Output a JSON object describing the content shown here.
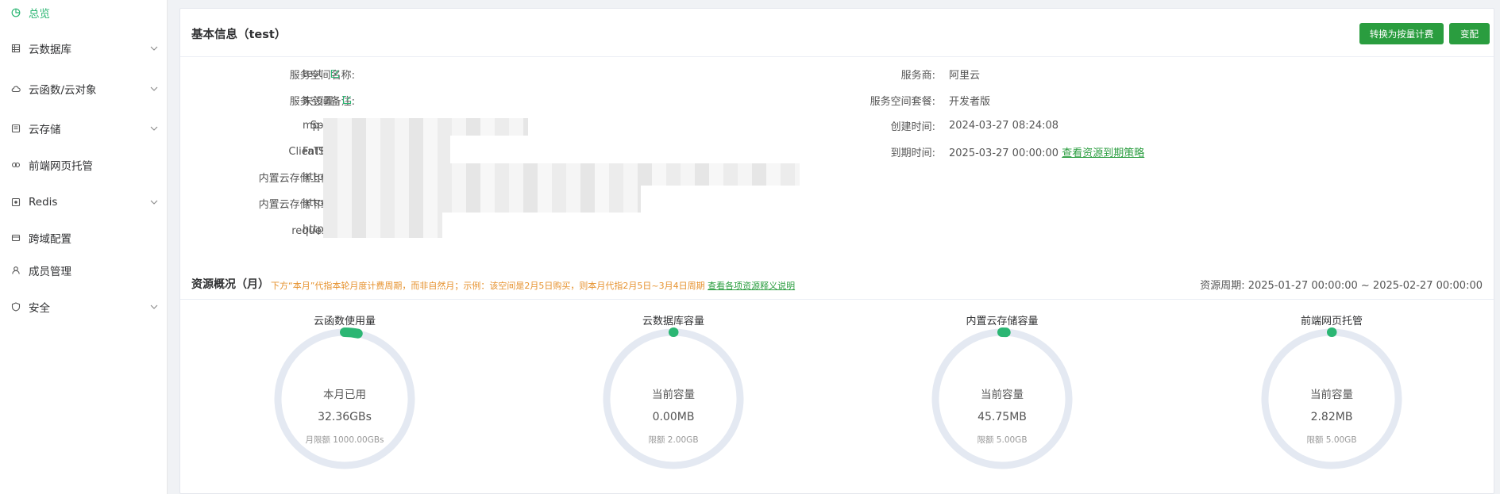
{
  "sidebar": {
    "items": [
      {
        "label": "总览",
        "icon": "overview-icon",
        "active": true
      },
      {
        "label": "云数据库",
        "icon": "database-icon",
        "expandable": true
      },
      {
        "label": "云函数/云对象",
        "icon": "cloud-icon",
        "expandable": true
      },
      {
        "label": "云存储",
        "icon": "storage-icon",
        "expandable": true
      },
      {
        "label": "前端网页托管",
        "icon": "hosting-icon"
      },
      {
        "label": "Redis",
        "icon": "redis-icon",
        "expandable": true
      },
      {
        "label": "跨域配置",
        "icon": "cors-icon"
      },
      {
        "label": "成员管理",
        "icon": "member-icon"
      },
      {
        "label": "安全",
        "icon": "shield-icon",
        "expandable": true
      }
    ]
  },
  "basic": {
    "title": "基本信息（test）",
    "btn_convert": "转换为按量计费",
    "btn_change": "变配",
    "left": [
      {
        "key": "服务空间名称:",
        "value": "test"
      },
      {
        "key": "服务空间备注:",
        "value": "未设置"
      },
      {
        "key": "SpaceId:",
        "value": "mp-"
      },
      {
        "key": "ClientSecret:",
        "value": "FaTF"
      },
      {
        "key": "内置云存储上传域名:",
        "value": "https:"
      },
      {
        "key": "内置云存储下载域名:",
        "value": "https:"
      },
      {
        "key": "request域名:",
        "value": "https:"
      }
    ],
    "right": [
      {
        "key": "服务商:",
        "value": "阿里云"
      },
      {
        "key": "服务空间套餐:",
        "value": "开发者版"
      },
      {
        "key": "创建时间:",
        "value": "2024-03-27 08:24:08"
      },
      {
        "key": "到期时间:",
        "value": "2025-03-27 00:00:00"
      }
    ],
    "expire_link": "查看资源到期策略"
  },
  "resources": {
    "title": "资源概况（月）",
    "note": "下方“本月”代指本轮月度计费周期，而非自然月；示例：该空间是2月5日购买，则本月代指2月5日~3月4日周期",
    "note_link": "查看各项资源释义说明",
    "period": "资源周期:  2025-01-27 00:00:00  ~  2025-02-27 00:00:00",
    "gauges": [
      {
        "title": "云函数使用量",
        "label": "本月已用",
        "value": "32.36GBs",
        "limit": "月限额 1000.00GBs",
        "fraction": 0.032
      },
      {
        "title": "云数据库容量",
        "label": "当前容量",
        "value": "0.00MB",
        "limit": "限额 2.00GB",
        "fraction": 0.0
      },
      {
        "title": "内置云存储容量",
        "label": "当前容量",
        "value": "45.75MB",
        "limit": "限额 5.00GB",
        "fraction": 0.009
      },
      {
        "title": "前端网页托管",
        "label": "当前容量",
        "value": "2.82MB",
        "limit": "限额 5.00GB",
        "fraction": 0.0006
      }
    ]
  },
  "colors": {
    "accent": "#2bb673",
    "button": "#2a9d3f",
    "track": "#e4e9f2",
    "warn": "#e6912c"
  }
}
